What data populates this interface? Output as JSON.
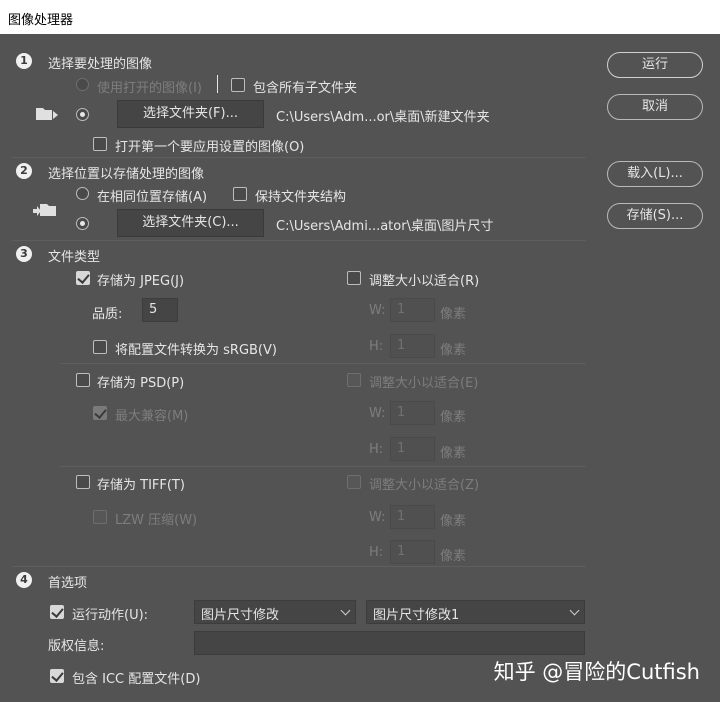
{
  "window": {
    "title": "图像处理器"
  },
  "buttons": {
    "run": "运行",
    "cancel": "取消",
    "load": "载入(L)...",
    "save": "存储(S)..."
  },
  "section1": {
    "number": "1",
    "title": "选择要处理的图像",
    "use_open_images": "使用打开的图像(I)",
    "include_subfolders": "包含所有子文件夹",
    "select_folder_btn": "选择文件夹(F)...",
    "source_path": "C:\\Users\\Adm...or\\桌面\\新建文件夹",
    "open_first_image": "打开第一个要应用设置的图像(O)"
  },
  "section2": {
    "number": "2",
    "title": "选择位置以存储处理的图像",
    "same_location": "在相同位置存储(A)",
    "keep_structure": "保持文件夹结构",
    "select_folder_btn": "选择文件夹(C)...",
    "dest_path": "C:\\Users\\Admi...ator\\桌面\\图片尺寸"
  },
  "section3": {
    "number": "3",
    "title": "文件类型",
    "jpeg": {
      "label": "存储为 JPEG(J)",
      "checked": true,
      "resize": "调整大小以适合(R)",
      "quality_label": "品质:",
      "quality_value": "5",
      "convert_srgb": "将配置文件转换为 sRGB(V)",
      "w_label": "W:",
      "w_value": "1",
      "h_label": "H:",
      "h_value": "1",
      "unit": "像素"
    },
    "psd": {
      "label": "存储为 PSD(P)",
      "checked": false,
      "resize": "调整大小以适合(E)",
      "max_compat": "最大兼容(M)",
      "w_label": "W:",
      "w_value": "1",
      "h_label": "H:",
      "h_value": "1",
      "unit": "像素"
    },
    "tiff": {
      "label": "存储为 TIFF(T)",
      "checked": false,
      "resize": "调整大小以适合(Z)",
      "lzw": "LZW 压缩(W)",
      "w_label": "W:",
      "w_value": "1",
      "h_label": "H:",
      "h_value": "1",
      "unit": "像素"
    }
  },
  "section4": {
    "number": "4",
    "title": "首选项",
    "run_action": "运行动作(U):",
    "action_set": "图片尺寸修改",
    "action_name": "图片尺寸修改1",
    "copyright_label": "版权信息:",
    "copyright_value": "",
    "include_icc": "包含 ICC 配置文件(D)"
  },
  "watermark": "知乎 @冒险的Cutfish",
  "colors": {
    "dialog_bg": "#535353",
    "field_bg": "#454545",
    "text": "#e6e6e6",
    "disabled_text": "#7d7d7d"
  }
}
